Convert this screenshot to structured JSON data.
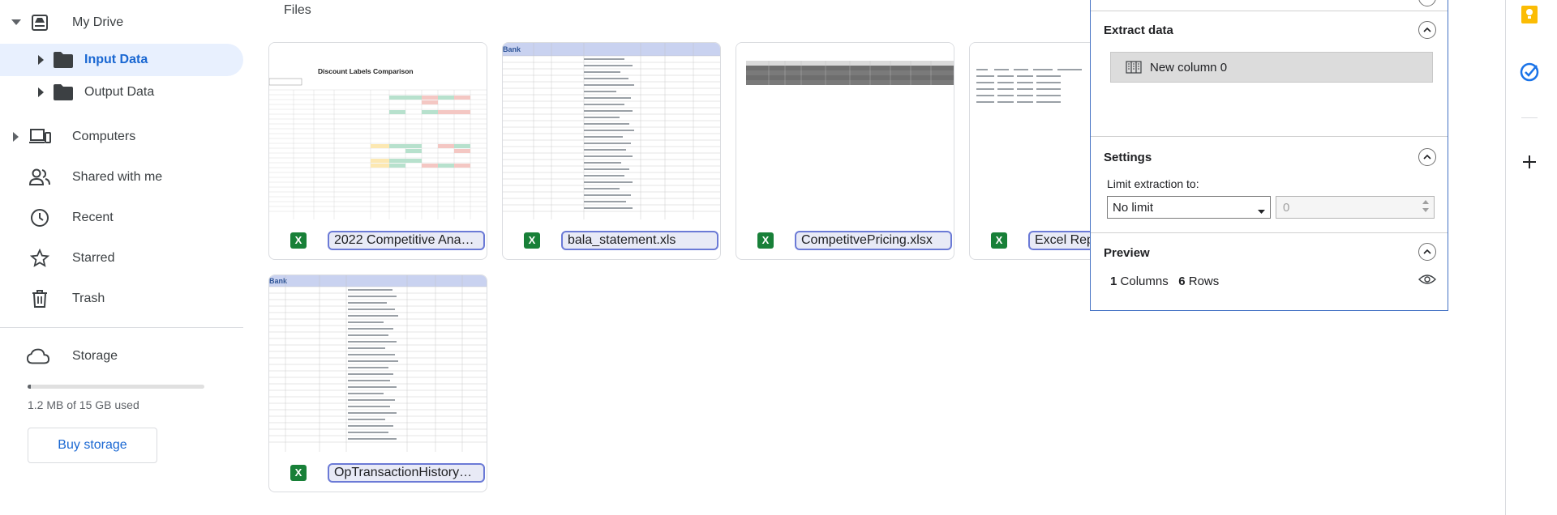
{
  "sidebar": {
    "my_drive": "My Drive",
    "input_data": "Input Data",
    "output_data": "Output Data",
    "computers": "Computers",
    "shared": "Shared with me",
    "recent": "Recent",
    "starred": "Starred",
    "trash": "Trash",
    "storage": "Storage",
    "storage_used_text": "1.2 MB of 15 GB used",
    "storage_used_fraction": 0.02,
    "buy_storage": "Buy storage"
  },
  "main": {
    "section_title": "Files",
    "files": [
      {
        "name": "2022 Competitive Ana…",
        "type_icon": "X"
      },
      {
        "name": "bala_statement.xls",
        "type_icon": "X"
      },
      {
        "name": "CompetitvePricing.xlsx",
        "type_icon": "X"
      },
      {
        "name": "Excel Repo",
        "type_icon": "X"
      },
      {
        "name": "OpTransactionHistory…",
        "type_icon": "X"
      }
    ],
    "thumb_title": "Discount Labels Comparison"
  },
  "panel": {
    "extract_title": "Extract data",
    "column_item": "New column 0",
    "settings_title": "Settings",
    "limit_label": "Limit extraction to:",
    "limit_selected": "No limit",
    "limit_value": "0",
    "preview_title": "Preview",
    "columns_count": "1",
    "columns_word": "Columns",
    "rows_count": "6",
    "rows_word": "Rows"
  },
  "colors": {
    "selected_bg": "#e8f0fe",
    "selected_text": "#1967d2",
    "excel_green": "#188038",
    "panel_border": "#4472c4",
    "keep_yellow": "#fbbc04",
    "tasks_blue": "#1a73e8"
  }
}
